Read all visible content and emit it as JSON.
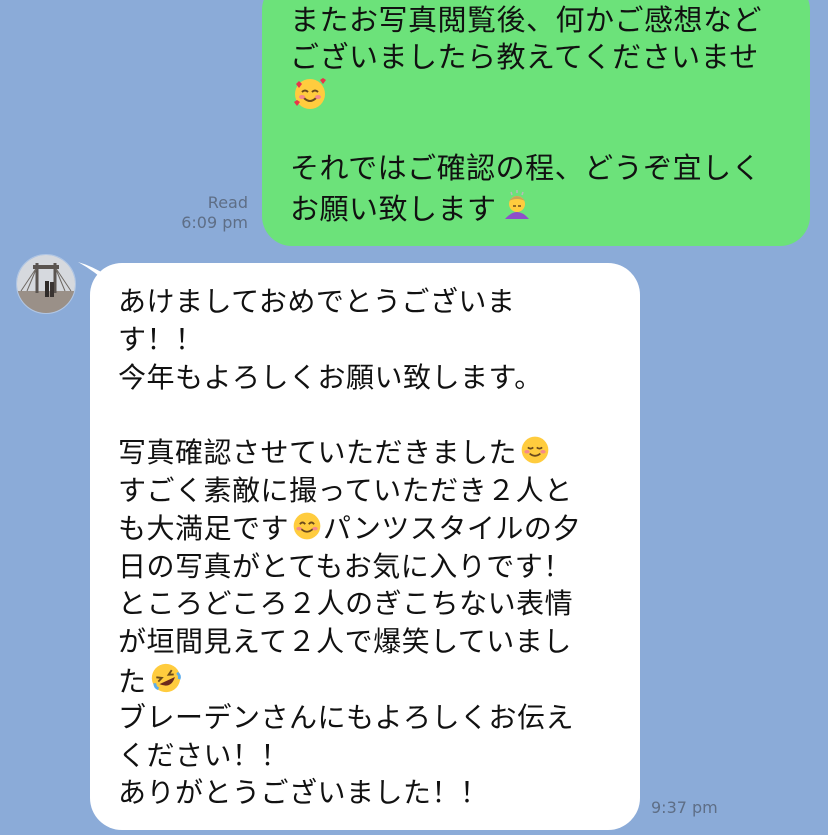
{
  "sent_message": {
    "lines": [
      "またお写真閲覧後、何かご感想など",
      "ございましたら教えてくださいませ",
      "",
      "",
      "それではご確認の程、どうぞ宜しく",
      "お願い致します"
    ],
    "read_label": "Read",
    "time": "6:09 pm",
    "emojis": [
      "smiling-face-with-hearts",
      "person-bowing"
    ]
  },
  "received_message": {
    "lines": [
      "あけましておめでとうございま",
      "す！！",
      "今年もよろしくお願い致します。",
      "",
      "写真確認させていただきました",
      "すごく素敵に撮っていただき２人と",
      "も大満足です",
      "パンツスタイルの夕",
      "日の写真がとてもお気に入りです！",
      "ところどころ２人のぎこちない表情",
      "が垣間見えて２人で爆笑していまし",
      "た",
      "ブレーデンさんにもよろしくお伝え",
      "ください！！",
      "ありがとうございました！！"
    ],
    "time": "9:37 pm",
    "emojis": [
      "smiling-face",
      "smiling-face-with-smiling-eyes",
      "rolling-on-floor-laughing"
    ]
  },
  "colors": {
    "background": "#8BABD8",
    "sent_bubble": "#6CE27A",
    "received_bubble": "#FFFFFF",
    "meta_text": "#5E6E86"
  }
}
